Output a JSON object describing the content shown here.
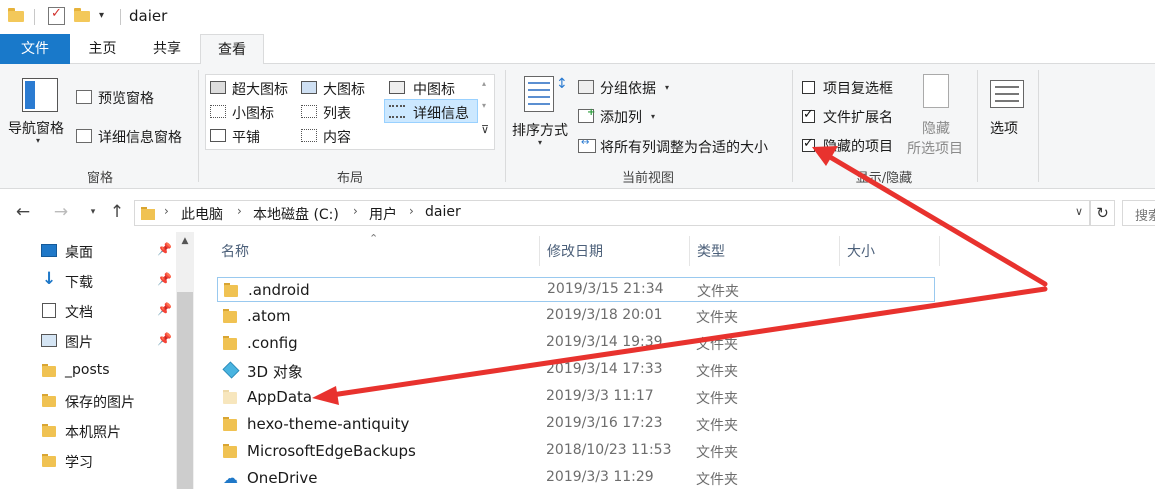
{
  "window": {
    "title": "daier"
  },
  "tabs": [
    {
      "label": "文件"
    },
    {
      "label": "主页"
    },
    {
      "label": "共享"
    },
    {
      "label": "查看"
    }
  ],
  "ribbon": {
    "panes": {
      "nav_pane": "导航窗格",
      "preview_pane": "预览窗格",
      "details_pane": "详细信息窗格",
      "group_label": "窗格"
    },
    "layout": {
      "items": [
        "超大图标",
        "大图标",
        "中图标",
        "小图标",
        "列表",
        "详细信息",
        "平铺",
        "内容"
      ],
      "selected": "详细信息",
      "group_label": "布局"
    },
    "current_view": {
      "sort_by": "排序方式",
      "group_by": "分组依据",
      "add_column": "添加列",
      "fit_columns": "将所有列调整为合适的大小",
      "group_label": "当前视图"
    },
    "show_hide": {
      "item_checkboxes": {
        "label": "项目复选框",
        "checked": false
      },
      "file_extensions": {
        "label": "文件扩展名",
        "checked": true
      },
      "hidden_items": {
        "label": "隐藏的项目",
        "checked": true
      },
      "hide_selected_line1": "隐藏",
      "hide_selected_line2": "所选项目",
      "group_label": "显示/隐藏"
    },
    "options": "选项"
  },
  "address": {
    "crumbs": [
      "此电脑",
      "本地磁盘 (C:)",
      "用户",
      "daier"
    ],
    "search_placeholder": "搜索"
  },
  "nav_pane": {
    "items": [
      {
        "label": "桌面",
        "icon": "desktop-icon",
        "pinned": true
      },
      {
        "label": "下载",
        "icon": "download-icon",
        "pinned": true
      },
      {
        "label": "文档",
        "icon": "document-icon",
        "pinned": true
      },
      {
        "label": "图片",
        "icon": "pictures-icon",
        "pinned": true
      },
      {
        "label": "_posts",
        "icon": "folder-icon",
        "pinned": false
      },
      {
        "label": "保存的图片",
        "icon": "folder-icon",
        "pinned": false
      },
      {
        "label": "本机照片",
        "icon": "folder-icon",
        "pinned": false
      },
      {
        "label": "学习",
        "icon": "folder-icon",
        "pinned": false
      }
    ]
  },
  "file_list": {
    "columns": [
      "名称",
      "修改日期",
      "类型",
      "大小"
    ],
    "rows": [
      {
        "name": ".android",
        "date": "2019/3/15 21:34",
        "type": "文件夹",
        "icon": "folder-icon"
      },
      {
        "name": ".atom",
        "date": "2019/3/18 20:01",
        "type": "文件夹",
        "icon": "folder-icon"
      },
      {
        "name": ".config",
        "date": "2019/3/14 19:39",
        "type": "文件夹",
        "icon": "folder-icon"
      },
      {
        "name": "3D 对象",
        "date": "2019/3/14 17:33",
        "type": "文件夹",
        "icon": "3d-objects-icon"
      },
      {
        "name": "AppData",
        "date": "2019/3/3 11:17",
        "type": "文件夹",
        "icon": "hidden-folder-icon"
      },
      {
        "name": "hexo-theme-antiquity",
        "date": "2019/3/16 17:23",
        "type": "文件夹",
        "icon": "folder-icon"
      },
      {
        "name": "MicrosoftEdgeBackups",
        "date": "2018/10/23 11:53",
        "type": "文件夹",
        "icon": "folder-icon"
      },
      {
        "name": "OneDrive",
        "date": "2019/3/3 11:29",
        "type": "文件夹",
        "icon": "onedrive-icon"
      }
    ]
  },
  "colors": {
    "accent": "#1979ca",
    "annotation_arrow": "#e8322e"
  }
}
